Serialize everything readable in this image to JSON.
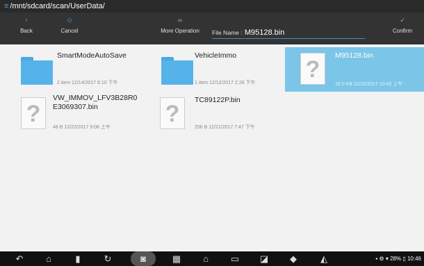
{
  "path": {
    "icon": "menu-lines-icon",
    "text": "/mnt/sdcard/scan/UserData/"
  },
  "toolbar": {
    "back_label": "Back",
    "cancel_label": "Cancel",
    "more_label": "More Operation",
    "file_name_label": "File Name :",
    "file_name_value": "M95128.bin",
    "confirm_label": "Confirm"
  },
  "files": [
    {
      "name": "SmartModeAutoSave",
      "type": "folder",
      "meta": "2  item    12/14/2017 6:10 下午",
      "selected": false
    },
    {
      "name": "VehicleImmo",
      "type": "folder",
      "meta": "1  item    12/12/2017 2:26 下午",
      "selected": false
    },
    {
      "name": "M95128.bin",
      "type": "file",
      "meta": "16.0 KB     12/22/2017 10:42 上午",
      "selected": true
    },
    {
      "name": "VW_IMMOV_LFV3B28R0E3069307.bin",
      "name_line1": "VW_IMMOV_LFV3B28R0",
      "name_line2": "E3069307.bin",
      "type": "file",
      "meta": "48 B     12/22/2017 9:08 上午",
      "selected": false
    },
    {
      "name": "TC89122P.bin",
      "type": "file",
      "meta": "256 B     12/21/2017 7:47 下午",
      "selected": false
    }
  ],
  "status": {
    "battery": "28%",
    "time": "10:46"
  },
  "colors": {
    "accent": "#3b8fd0",
    "selected": "#7bc5e8",
    "folder": "#55b3ea"
  }
}
